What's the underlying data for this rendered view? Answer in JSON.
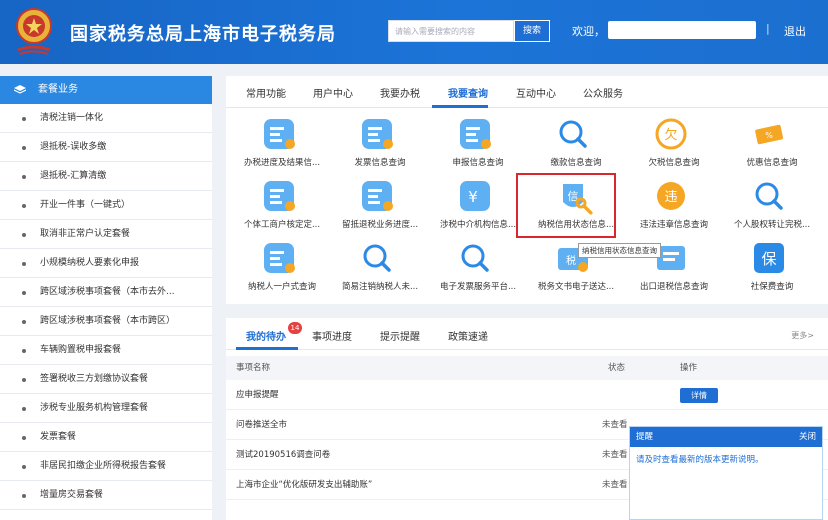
{
  "header": {
    "title": "国家税务总局上海市电子税务局",
    "search_placeholder": "请输入需要搜索的内容",
    "search_button": "搜索",
    "welcome": "欢迎，",
    "separator": "|",
    "logout": "退出",
    "colors": {
      "bar": "#1765c4",
      "accent": "#1f6ed4"
    }
  },
  "sidebar": {
    "title": "套餐业务",
    "items": [
      "清税注销一体化",
      "退抵税-误收多缴",
      "退抵税-汇算清缴",
      "开业一件事（一键式）",
      "取消非正常户认定套餐",
      "小规模纳税人要素化申报",
      "跨区域涉税事项套餐（本市去外...",
      "跨区域涉税事项套餐（本市跨区）",
      "车辆购置税申报套餐",
      "签署税收三方划缴协议套餐",
      "涉税专业服务机构管理套餐",
      "发票套餐",
      "非居民扣缴企业所得税报告套餐",
      "增量房交易套餐"
    ]
  },
  "tabs": [
    "常用功能",
    "用户中心",
    "我要办税",
    "我要查询",
    "互动中心",
    "公众服务"
  ],
  "active_tab": "我要查询",
  "query_items": [
    {
      "label": "办税进度及结果信...",
      "icon": "document-status-icon"
    },
    {
      "label": "发票信息查询",
      "icon": "invoice-search-icon"
    },
    {
      "label": "申报信息查询",
      "icon": "declaration-upload-icon"
    },
    {
      "label": "缴款信息查询",
      "icon": "magnifier-icon"
    },
    {
      "label": "欠税信息查询",
      "icon": "owed-tax-icon"
    },
    {
      "label": "优惠信息查询",
      "icon": "discount-ticket-icon"
    },
    {
      "label": "个体工商户核定定...",
      "icon": "business-person-icon"
    },
    {
      "label": "留抵退税业务进度...",
      "icon": "refund-progress-icon"
    },
    {
      "label": "涉税中介机构信息...",
      "icon": "agency-yuan-icon"
    },
    {
      "label": "纳税信用状态信息...",
      "icon": "credit-search-icon"
    },
    {
      "label": "违法违章信息查询",
      "icon": "violation-icon"
    },
    {
      "label": "个人股权转让完税...",
      "icon": "magnifier-icon"
    },
    {
      "label": "纳税人一户式查询",
      "icon": "taxpayer-card-icon"
    },
    {
      "label": "简易注销纳税人未...",
      "icon": "magnifier-icon"
    },
    {
      "label": "电子发票服务平台...",
      "icon": "magnifier-icon"
    },
    {
      "label": "税务文书电子送达...",
      "icon": "tax-document-icon"
    },
    {
      "label": "出口退税信息查询",
      "icon": "export-refund-icon"
    },
    {
      "label": "社保费查询",
      "icon": "social-insurance-icon"
    }
  ],
  "tooltip": "纳税信用状态信息查询",
  "todo": {
    "tabs": [
      "我的待办",
      "事项进度",
      "提示提醒",
      "政策速递"
    ],
    "badge": "14",
    "more": "更多>",
    "columns": [
      "事项名称",
      "状态",
      "操作"
    ],
    "rows": [
      {
        "name": "应申报提醒",
        "status": "",
        "action": "详情"
      },
      {
        "name": "问卷推送全市",
        "status": "未查看",
        "action": ""
      },
      {
        "name": "测试20190516调查问卷",
        "status": "未查看",
        "action": ""
      },
      {
        "name": "上海市企业“优化版研发支出辅助账”",
        "status": "未查看",
        "action": ""
      }
    ]
  },
  "popup": {
    "title": "提醒",
    "close": "关闭",
    "message": "请及时查看最新的版本更新说明。"
  }
}
